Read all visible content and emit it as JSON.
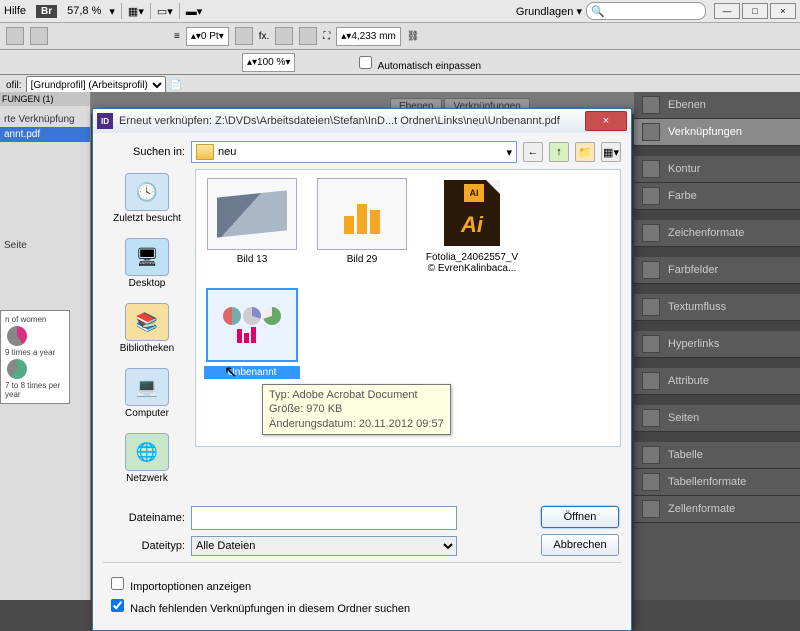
{
  "topbar": {
    "help": "Hilfe",
    "br": "Br",
    "zoom": "57,8 %",
    "workspace": "Grundlagen",
    "min": "—",
    "max": "□",
    "close": "×"
  },
  "optbar": {
    "pt_value": "0 Pt",
    "size_value": "4,233 mm",
    "pct": "100 %",
    "autofit": "Automatisch einpassen"
  },
  "profile": {
    "label": "ofil:",
    "value": "[Grundprofil] (Arbeitsprofil)"
  },
  "leftpane": {
    "hdr": "FUNGEN (1)",
    "sub": "rte Verknüpfung",
    "sel": "annt.pdf",
    "seite": "Seite"
  },
  "doc_thumb": {
    "t1": "n of women",
    "t2": "9 times a year",
    "t3": "7 to 8 times per year"
  },
  "tabs": {
    "t1": "Ebenen",
    "t2": "Verknüpfungen"
  },
  "panels": {
    "p0": "Ebenen",
    "p1": "Verknüpfungen",
    "p2": "Kontur",
    "p3": "Farbe",
    "p4": "Zeichenformate",
    "p5": "Farbfelder",
    "p6": "Textumfluss",
    "p7": "Hyperlinks",
    "p8": "Attribute",
    "p9": "Seiten",
    "p10": "Tabelle",
    "p11": "Tabellenformate",
    "p12": "Zellenformate"
  },
  "dialog": {
    "title": "Erneut verknüpfen: Z:\\DVDs\\Arbeitsdateien\\Stefan\\InD...t Ordner\\Links\\neu\\Unbenannt.pdf",
    "close": "×",
    "search_in": "Suchen in:",
    "folder": "neu",
    "back": "←",
    "up": "↑",
    "newf": "📁",
    "view": "▦",
    "places": {
      "recent": "Zuletzt besucht",
      "desktop": "Desktop",
      "libs": "Bibliotheken",
      "computer": "Computer",
      "network": "Netzwerk"
    },
    "files": {
      "f1": "Bild 13",
      "f2": "Bild 29",
      "f3a": "Fotolia_24062557_V",
      "f3b": "© EvrenKalinbaca...",
      "f4": "Unbenannt"
    },
    "tooltip": {
      "l1": "Typ: Adobe Acrobat Document",
      "l2": "Größe: 970 KB",
      "l3": "Änderungsdatum: 20.11.2012 09:57"
    },
    "filename_lbl": "Dateiname:",
    "filename_val": "",
    "filetype_lbl": "Dateityp:",
    "filetype_val": "Alle Dateien",
    "open": "Öffnen",
    "cancel": "Abbrechen",
    "chk1": "Importoptionen anzeigen",
    "chk2": "Nach fehlenden Verknüpfungen in diesem Ordner suchen"
  }
}
